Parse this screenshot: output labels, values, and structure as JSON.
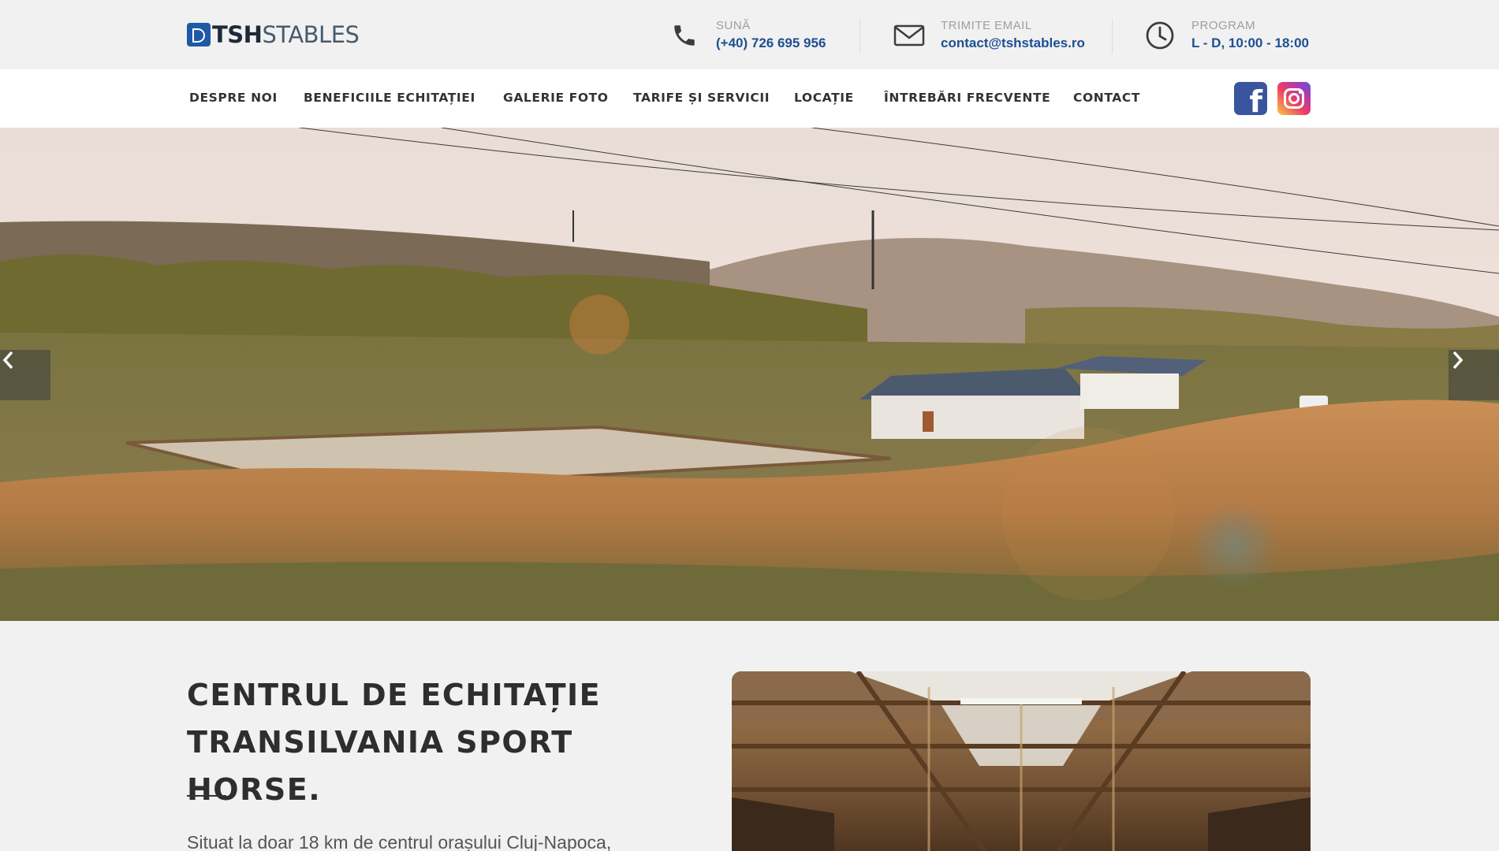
{
  "brand": {
    "logo_bold": "TSH",
    "logo_light": "STABLES"
  },
  "topbar": {
    "phone": {
      "label": "SUNĂ",
      "value": "(+40) 726 695 956",
      "icon": "phone-icon"
    },
    "email": {
      "label": "TRIMITE EMAIL",
      "value": "contact@tshstables.ro",
      "icon": "envelope-icon"
    },
    "hours": {
      "label": "PROGRAM",
      "value": "L - D, 10:00 - 18:00",
      "icon": "clock-icon"
    }
  },
  "nav": {
    "items": [
      {
        "label": "DESPRE NOI"
      },
      {
        "label": "BENEFICIILE ECHITAȚIEI"
      },
      {
        "label": "GALERIE FOTO"
      },
      {
        "label": "TARIFE ȘI SERVICII"
      },
      {
        "label": "LOCAȚIE"
      },
      {
        "label": "ÎNTREBĂRI FRECVENTE"
      },
      {
        "label": "CONTACT"
      }
    ],
    "social": [
      {
        "name": "facebook",
        "icon": "facebook-icon",
        "color": "#3a559f"
      },
      {
        "name": "instagram",
        "icon": "instagram-icon"
      }
    ]
  },
  "hero": {
    "prev_icon": "chevron-left-icon",
    "next_icon": "chevron-right-icon"
  },
  "intro": {
    "title_line1": "CENTRUL DE ECHITAȚIE",
    "title_line2": "TRANSILVANIA SPORT HORSE.",
    "text": "Situat la doar 18 km de centrul orașului Cluj-Napoca,"
  },
  "colors": {
    "accent": "#1d4f91",
    "brand": "#1f5aa6",
    "nav_bg": "#ffffff",
    "page_bg": "#f1f1f1"
  }
}
